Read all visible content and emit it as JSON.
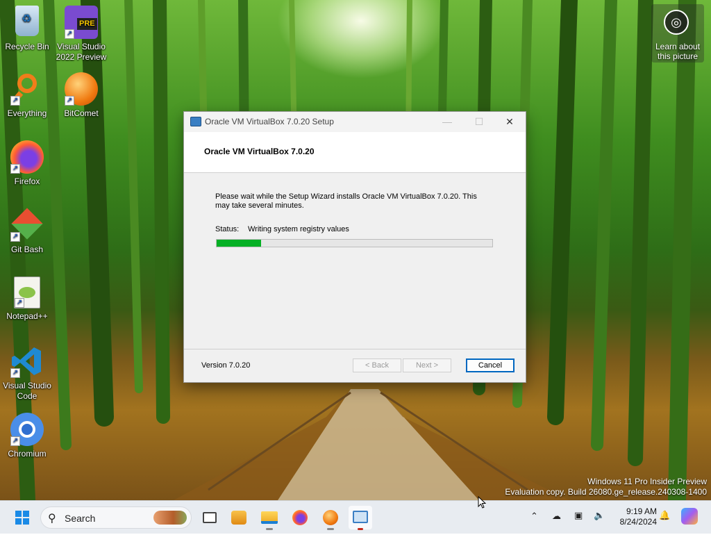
{
  "desktop": {
    "icons": [
      {
        "label": "Recycle Bin",
        "icon": "recycle-bin-icon"
      },
      {
        "label": "Visual Studio 2022 Preview",
        "icon": "visual-studio-preview-icon",
        "badge": "PRE"
      },
      {
        "label": "Everything",
        "icon": "everything-search-icon"
      },
      {
        "label": "BitComet",
        "icon": "bitcomet-icon"
      },
      {
        "label": "Firefox",
        "icon": "firefox-icon"
      },
      {
        "label": "Git Bash",
        "icon": "git-bash-icon"
      },
      {
        "label": "Notepad++",
        "icon": "notepad-plus-plus-icon"
      },
      {
        "label": "Visual Studio Code",
        "icon": "vscode-icon"
      },
      {
        "label": "Chromium",
        "icon": "chromium-icon"
      }
    ],
    "learn_about": "Learn about this picture",
    "watermark": {
      "line1": "Windows 11 Pro Insider Preview",
      "line2": "Evaluation copy. Build 26080.ge_release.240308-1400"
    }
  },
  "dialog": {
    "window_title": "Oracle VM VirtualBox 7.0.20 Setup",
    "header_title": "Oracle VM VirtualBox 7.0.20",
    "message": "Please wait while the Setup Wizard installs Oracle VM VirtualBox 7.0.20. This may take several minutes.",
    "status_label": "Status:",
    "status_value": "Writing system registry values",
    "progress_fraction": 0.16,
    "version": "Version 7.0.20",
    "buttons": {
      "back": "< Back",
      "next": "Next >",
      "cancel": "Cancel"
    },
    "window_controls": {
      "minimize": "—",
      "maximize": "☐",
      "close": "✕"
    }
  },
  "taskbar": {
    "search_placeholder": "Search",
    "pinned": [
      "start-icon",
      "task-view-icon",
      "app-icon",
      "file-explorer-icon",
      "firefox-icon",
      "bitcomet-icon",
      "virtualbox-installer-icon"
    ],
    "clock": {
      "time": "9:19 AM",
      "date": "8/24/2024"
    }
  },
  "colors": {
    "progress": "#06b025",
    "accent": "#0067c0"
  }
}
